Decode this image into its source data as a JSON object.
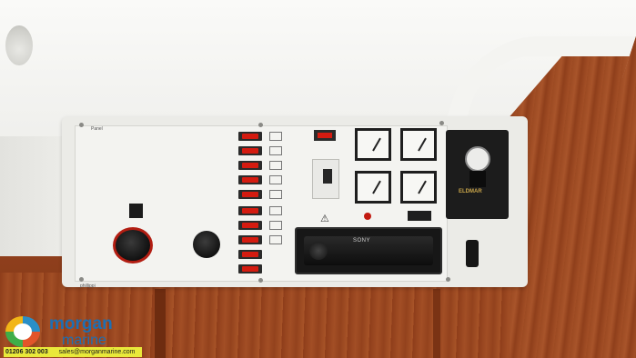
{
  "photo": {
    "subject": "",
    "panel_labels": {
      "top_left": "Panel",
      "bottom_left": "phillippi"
    },
    "radio_brand": "SONY",
    "heater_brand": "ELDMAR",
    "warning_symbol": "⚠"
  },
  "watermark": {
    "name": "morgan",
    "sub": "marine",
    "phone": "01206 302 003",
    "email": "sales@morganmarine.com",
    "colors": {
      "brand": "#1d6fb3",
      "bar": "#e9e93a"
    }
  }
}
